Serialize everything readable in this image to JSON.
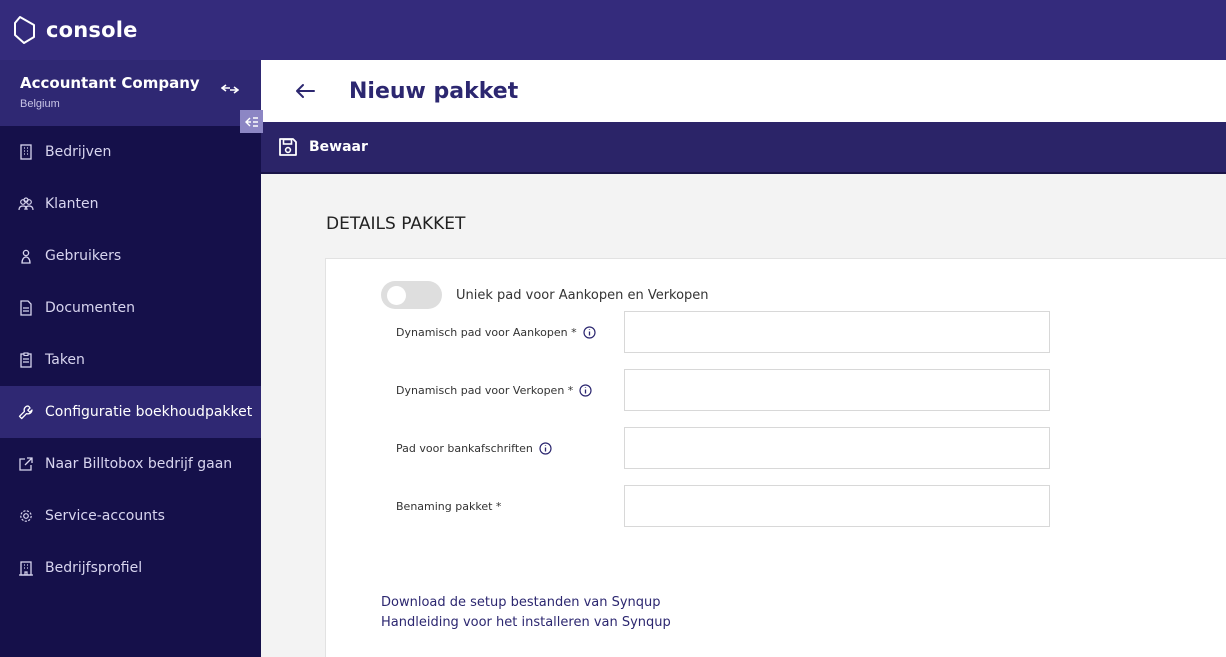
{
  "app": {
    "logo_text": "console"
  },
  "company": {
    "name": "Accountant Company",
    "country": "Belgium"
  },
  "nav": {
    "items": [
      {
        "label": "Bedrijven",
        "icon": "building-icon"
      },
      {
        "label": "Klanten",
        "icon": "users-icon"
      },
      {
        "label": "Gebruikers",
        "icon": "user-icon"
      },
      {
        "label": "Documenten",
        "icon": "document-icon"
      },
      {
        "label": "Taken",
        "icon": "clipboard-icon"
      },
      {
        "label": "Configuratie boekhoudpakket",
        "icon": "wrench-icon",
        "active": true
      },
      {
        "label": "Naar Billtobox bedrijf gaan",
        "icon": "external-link-icon"
      },
      {
        "label": "Service-accounts",
        "icon": "gear-icon"
      },
      {
        "label": "Bedrijfsprofiel",
        "icon": "office-icon"
      }
    ]
  },
  "header": {
    "title": "Nieuw pakket"
  },
  "toolbar": {
    "save_label": "Bewaar"
  },
  "section": {
    "title": "DETAILS PAKKET"
  },
  "form": {
    "toggle_label": "Uniek pad voor Aankopen en Verkopen",
    "toggle_on": false,
    "fields": [
      {
        "label": "Dynamisch pad voor Aankopen *",
        "value": "",
        "info": true
      },
      {
        "label": "Dynamisch pad voor Verkopen *",
        "value": "",
        "info": true
      },
      {
        "label": "Pad voor bankafschriften",
        "value": "",
        "info": true
      },
      {
        "label": "Benaming pakket *",
        "value": "",
        "info": false
      }
    ]
  },
  "links": {
    "download": "Download de setup bestanden van Synqup",
    "manual": "Handleiding voor het installeren van Synqup"
  },
  "colors": {
    "brand": "#342b7c",
    "sidebar": "#15104a",
    "accent_text": "#2c2770"
  }
}
